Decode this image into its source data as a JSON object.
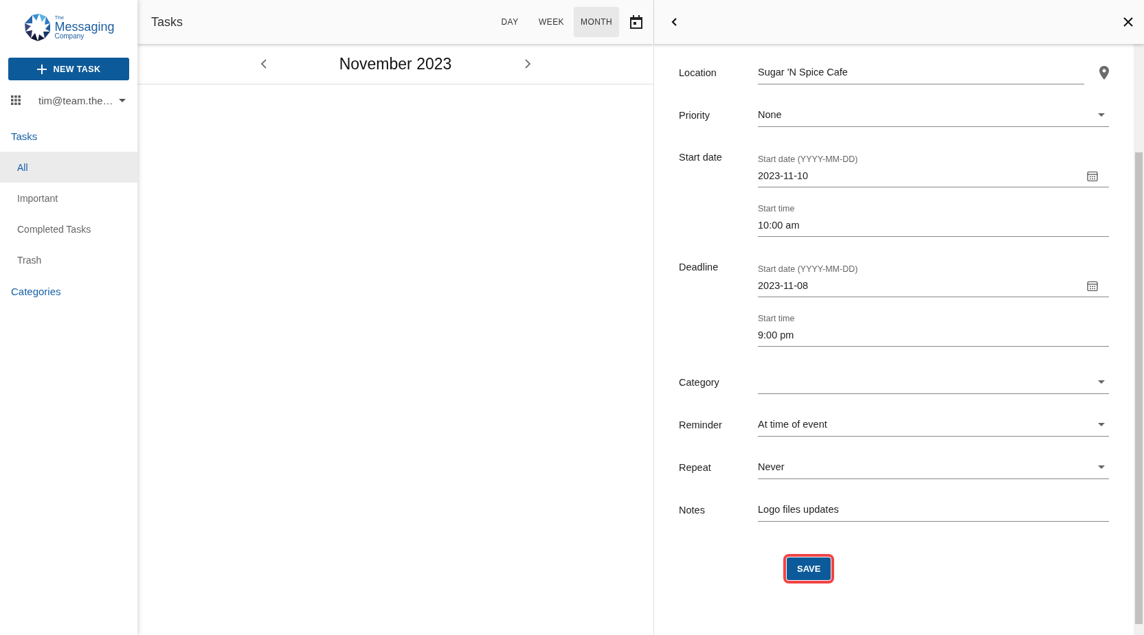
{
  "logo": {
    "small": "The",
    "main": "Messaging",
    "sub": "Company"
  },
  "new_task_button": {
    "label": "NEW TASK"
  },
  "account": {
    "email": "tim@team.the…"
  },
  "sidebar": {
    "sections": [
      {
        "title": "Tasks",
        "items": [
          {
            "label": "All",
            "selected": true
          },
          {
            "label": "Important",
            "selected": false
          },
          {
            "label": "Completed Tasks",
            "selected": false
          },
          {
            "label": "Trash",
            "selected": false
          }
        ]
      },
      {
        "title": "Categories"
      }
    ]
  },
  "header": {
    "title": "Tasks",
    "view_tabs": [
      {
        "label": "DAY",
        "selected": false
      },
      {
        "label": "WEEK",
        "selected": false
      },
      {
        "label": "MONTH",
        "selected": true
      }
    ]
  },
  "calendar": {
    "month": "November 2023"
  },
  "form": {
    "rows": [
      {
        "kind": "text",
        "label": "Location",
        "value": "Sugar 'N Spice Cafe"
      },
      {
        "kind": "select",
        "label": "Priority",
        "value": "None"
      },
      {
        "kind": "datetime",
        "label": "Start date",
        "date_label": "Start date (YYYY-MM-DD)",
        "date": "2023-11-10",
        "time_label": "Start time",
        "time": "10:00 am"
      },
      {
        "kind": "datetime",
        "label": "Deadline",
        "date_label": "Start date (YYYY-MM-DD)",
        "date": "2023-11-08",
        "time_label": "Start time",
        "time": "9:00 pm"
      },
      {
        "kind": "select",
        "label": "Category"
      },
      {
        "kind": "select",
        "label": "Reminder",
        "value": "At time of event"
      },
      {
        "kind": "select",
        "label": "Repeat",
        "value": "Never"
      },
      {
        "kind": "plain",
        "label": "Notes",
        "value": "Logo files updates"
      }
    ],
    "save_button": {
      "label": "SAVE",
      "highlighted": true
    }
  }
}
